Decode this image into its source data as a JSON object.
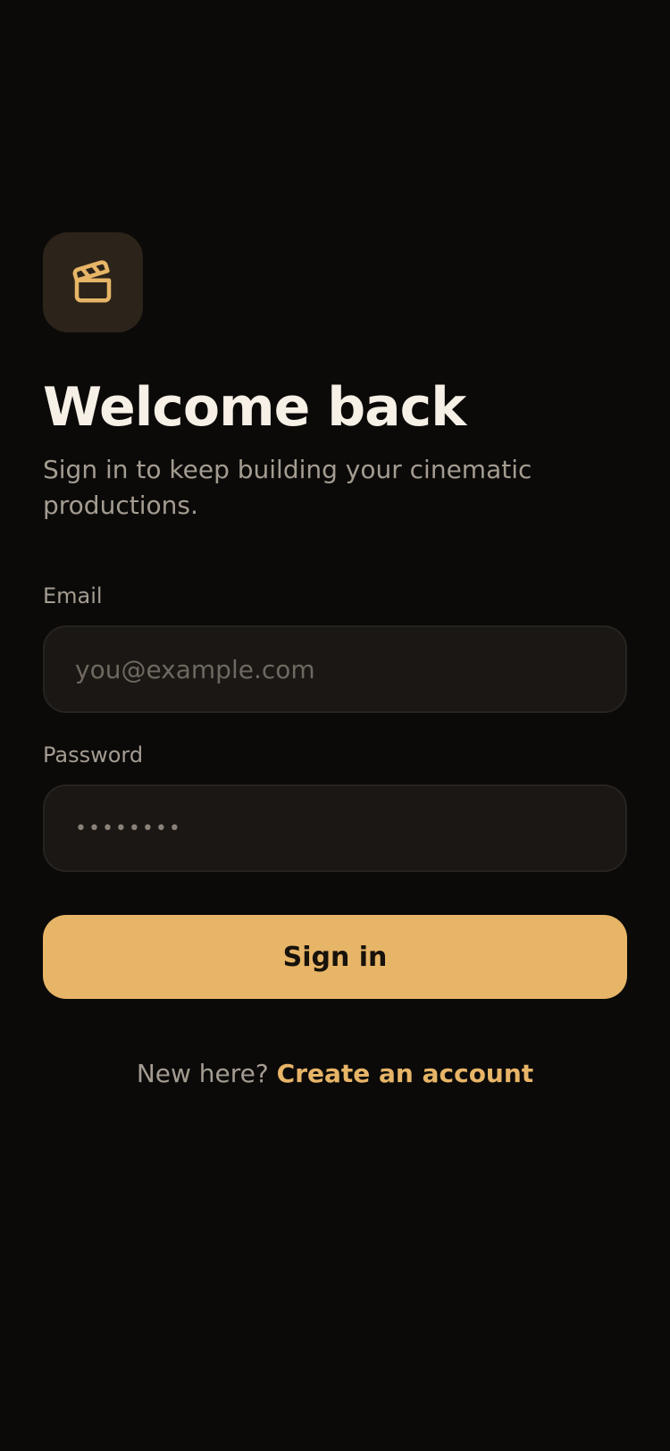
{
  "brand": {
    "logo_icon": "clapperboard-icon",
    "accent_color": "#e7b567",
    "tile_color": "#2c241a"
  },
  "header": {
    "title": "Welcome back",
    "subtitle": "Sign in to keep building your cinematic productions."
  },
  "form": {
    "email_label": "Email",
    "email_placeholder": "you@example.com",
    "email_value": "",
    "password_label": "Password",
    "password_placeholder": "••••••••",
    "password_value": "",
    "submit_label": "Sign in"
  },
  "footer": {
    "prompt": "New here?",
    "link_label": "Create an account"
  },
  "colors": {
    "background": "#0b0a09",
    "input_background": "#1a1714",
    "title_text": "#f6f0e6",
    "muted_text": "#a49c91",
    "button_text": "#17120b"
  }
}
